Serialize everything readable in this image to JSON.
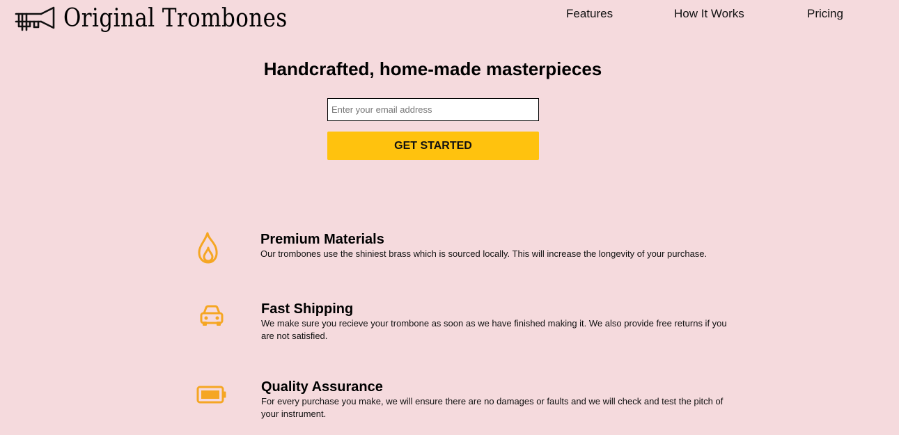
{
  "header": {
    "brand": "Original Trombones",
    "logo_icon": "trombone-icon",
    "nav": {
      "features": "Features",
      "how_it_works": "How It Works",
      "pricing": "Pricing"
    }
  },
  "hero": {
    "title": "Handcrafted, home-made masterpieces",
    "email_placeholder": "Enter your email address",
    "cta_label": "GET STARTED"
  },
  "features": [
    {
      "icon": "fire-icon",
      "title": "Premium Materials",
      "description": "Our trombones use the shiniest brass which is sourced locally. This will increase the longevity of your purchase."
    },
    {
      "icon": "car-icon",
      "title": "Fast Shipping",
      "description": "We make sure you recieve your trombone as soon as we have finished making it. We also provide free returns if you are not satisfied."
    },
    {
      "icon": "battery-icon",
      "title": "Quality Assurance",
      "description": "For every purchase you make, we will ensure there are no damages or faults and we will check and test the pitch of your instrument."
    }
  ],
  "colors": {
    "background": "#f5dadd",
    "accent": "#ffc20e",
    "icon": "#f5a623"
  }
}
